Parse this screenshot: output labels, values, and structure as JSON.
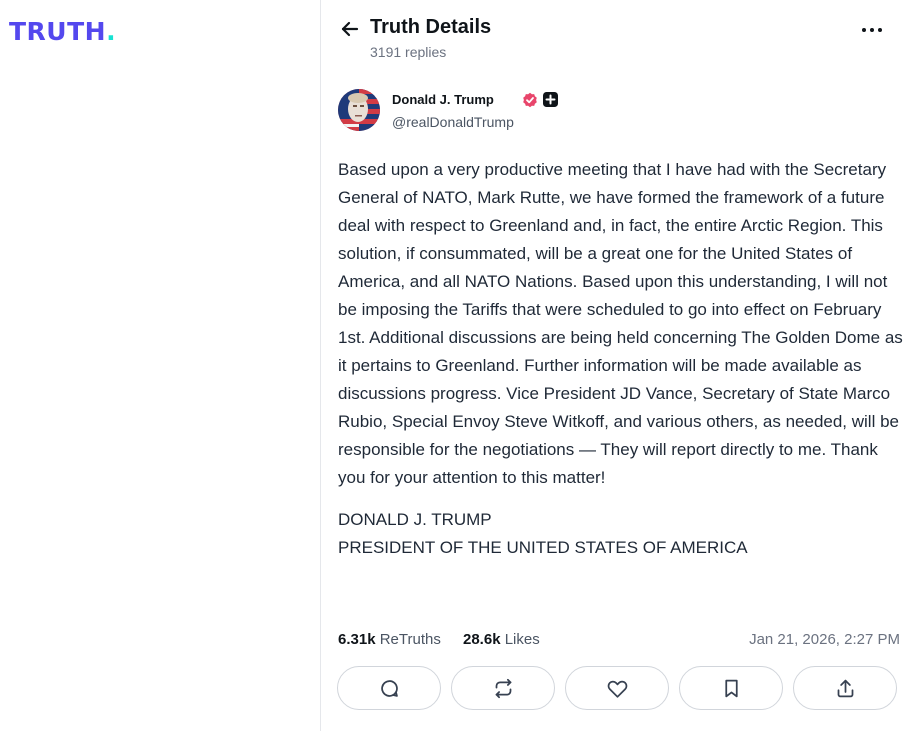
{
  "brand": {
    "logo_text": "TRUTH",
    "logo_dot": ".",
    "accent": "#5448ee",
    "dot_color": "#17e2d2"
  },
  "header": {
    "title": "Truth Details",
    "replies": "3191 replies",
    "back_icon": "arrow-left-icon",
    "more_icon": "more-horizontal-icon"
  },
  "author": {
    "name": "Donald J. Trump",
    "handle": "@realDonaldTrump",
    "verified_color": "#e8456b"
  },
  "post": {
    "paragraphs": [
      "Based upon a very productive meeting that I have had with the Secretary General of NATO, Mark Rutte, we have formed the framework of a future deal with respect to Greenland and, in fact, the entire Arctic Region. This solution, if consummated, will be a great one for the United States of America, and all NATO Nations. Based upon this understanding, I will not be imposing the Tariffs that were scheduled to go into effect on February 1st. Additional discussions are being held concerning The Golden Dome as it pertains to Greenland. Further information will be made available as discussions progress. Vice President JD Vance, Secretary of State Marco Rubio, Special Envoy Steve Witkoff, and various others, as needed, will be responsible for the negotiations — They will report directly to me. Thank you for your attention to this matter!",
      "DONALD J. TRUMP\nPRESIDENT OF THE UNITED STATES OF AMERICA"
    ]
  },
  "stats": {
    "retruths_count": "6.31k",
    "retruths_label": "ReTruths",
    "likes_count": "28.6k",
    "likes_label": "Likes",
    "timestamp": "Jan 21, 2026, 2:27 PM"
  },
  "actions": [
    {
      "name": "reply",
      "icon": "comment-icon"
    },
    {
      "name": "retruth",
      "icon": "retruth-icon"
    },
    {
      "name": "like",
      "icon": "heart-icon"
    },
    {
      "name": "bookmark",
      "icon": "bookmark-icon"
    },
    {
      "name": "share",
      "icon": "share-icon"
    }
  ]
}
